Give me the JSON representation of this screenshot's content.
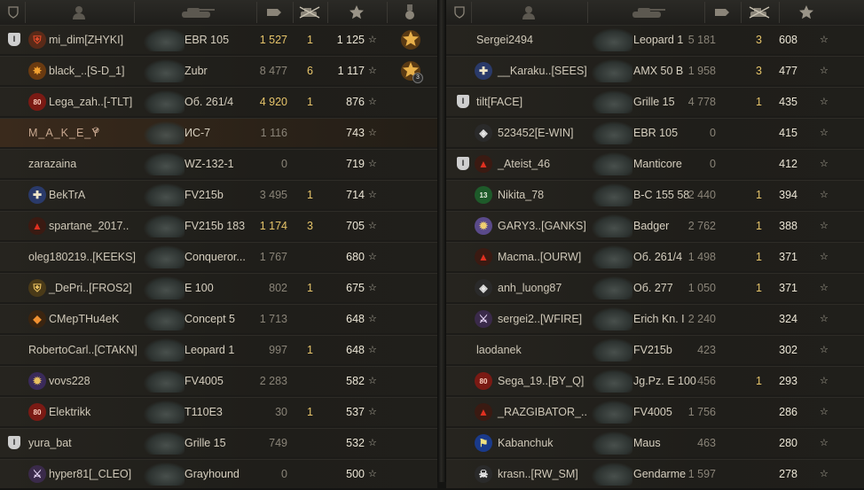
{
  "header_icons": [
    "platoon-shield-icon",
    "player-silhouette-icon",
    "tank-silhouette-icon",
    "damage-shell-icon",
    "frags-tank-icon",
    "experience-star-icon",
    "medal-icon"
  ],
  "left_team": [
    {
      "platoon": "I",
      "clan_icon": "clan-emblem-red-shield",
      "name": "mi_dim[ZHYKI]",
      "tank": "EBR 105",
      "damage": "1 527",
      "damage_hi": true,
      "frags": "1",
      "xp": "1 125",
      "star": "☆",
      "medal": "gold-medal",
      "medal_count": ""
    },
    {
      "platoon": "",
      "clan_icon": "clan-emblem-orange",
      "name": "black_..[S-D_1]",
      "tank": "Zubr",
      "damage": "8 477",
      "damage_hi": false,
      "frags": "6",
      "xp": "1 117",
      "star": "☆",
      "medal": "gold-medal",
      "medal_count": "3"
    },
    {
      "platoon": "",
      "clan_icon": "clan-emblem-red-80",
      "name": "Lega_zah..[-TLT]",
      "tank": "Об. 261/4",
      "damage": "4 920",
      "damage_hi": true,
      "frags": "1",
      "xp": "876",
      "star": "☆",
      "medal": "",
      "medal_count": ""
    },
    {
      "platoon": "",
      "clan_icon": "",
      "name": "M_A_K_E_Y",
      "tank": "ИС-7",
      "damage": "1 116",
      "damage_hi": false,
      "frags": "",
      "xp": "743",
      "star": "☆",
      "medal": "",
      "medal_count": "",
      "player": true
    },
    {
      "platoon": "",
      "clan_icon": "",
      "name": "zarazaina",
      "tank": "WZ-132-1",
      "damage": "0",
      "damage_hi": false,
      "frags": "",
      "xp": "719",
      "star": "☆",
      "medal": "",
      "medal_count": ""
    },
    {
      "platoon": "",
      "clan_icon": "clan-emblem-blue-cross",
      "name": "BekTrA",
      "tank": "FV215b",
      "damage": "3 495",
      "damage_hi": false,
      "frags": "1",
      "xp": "714",
      "star": "☆",
      "medal": "",
      "medal_count": ""
    },
    {
      "platoon": "",
      "clan_icon": "clan-emblem-red-triangle",
      "name": "spartane_2017..",
      "tank": "FV215b 183",
      "damage": "1 174",
      "damage_hi": true,
      "frags": "3",
      "xp": "705",
      "star": "☆",
      "medal": "",
      "medal_count": ""
    },
    {
      "platoon": "",
      "clan_icon": "",
      "name": "oleg180219..[KEEKS]",
      "tank": "Conqueror...",
      "damage": "1 767",
      "damage_hi": false,
      "frags": "",
      "xp": "680",
      "star": "☆",
      "medal": "",
      "medal_count": ""
    },
    {
      "platoon": "",
      "clan_icon": "clan-emblem-gold-shield",
      "name": "_DePri..[FROS2]",
      "tank": "E 100",
      "damage": "802",
      "damage_hi": false,
      "frags": "1",
      "xp": "675",
      "star": "☆",
      "medal": "",
      "medal_count": ""
    },
    {
      "platoon": "",
      "clan_icon": "clan-emblem-orange-diamond",
      "name": "CMepTHu4eK",
      "tank": "Concept 5",
      "damage": "1 713",
      "damage_hi": false,
      "frags": "",
      "xp": "648",
      "star": "☆",
      "medal": "",
      "medal_count": ""
    },
    {
      "platoon": "",
      "clan_icon": "",
      "name": "RobertoCarl..[CTAKN]",
      "tank": "Leopard 1",
      "damage": "997",
      "damage_hi": false,
      "frags": "1",
      "xp": "648",
      "star": "☆",
      "medal": "",
      "medal_count": ""
    },
    {
      "platoon": "",
      "clan_icon": "clan-emblem-purple-gear",
      "name": "vovs228",
      "tank": "FV4005",
      "damage": "2 283",
      "damage_hi": false,
      "frags": "",
      "xp": "582",
      "star": "☆",
      "medal": "",
      "medal_count": ""
    },
    {
      "platoon": "",
      "clan_icon": "clan-emblem-red-80",
      "name": "Elektrikk",
      "tank": "T110E3",
      "damage": "30",
      "damage_hi": false,
      "frags": "1",
      "xp": "537",
      "star": "☆",
      "medal": "",
      "medal_count": ""
    },
    {
      "platoon": "I",
      "clan_icon": "",
      "name": "yura_bat",
      "tank": "Grille 15",
      "damage": "749",
      "damage_hi": false,
      "frags": "",
      "xp": "532",
      "star": "☆",
      "medal": "",
      "medal_count": ""
    },
    {
      "platoon": "",
      "clan_icon": "clan-emblem-purple-sword",
      "name": "hyper81[_CLEO]",
      "tank": "Grayhound",
      "damage": "0",
      "damage_hi": false,
      "frags": "",
      "xp": "500",
      "star": "☆",
      "medal": "",
      "medal_count": ""
    }
  ],
  "right_team": [
    {
      "platoon": "",
      "clan_icon": "",
      "name": "Sergei2494",
      "tank": "Leopard 1",
      "damage": "5 181",
      "frags": "3",
      "xp": "608",
      "star": "☆"
    },
    {
      "platoon": "",
      "clan_icon": "clan-emblem-blue-cross",
      "name": "__Karaku..[SEES]",
      "tank": "AMX 50 B",
      "damage": "1 958",
      "frags": "3",
      "xp": "477",
      "star": "☆"
    },
    {
      "platoon": "I",
      "clan_icon": "",
      "name": "tilt[FACE]",
      "tank": "Grille 15",
      "damage": "4 778",
      "frags": "1",
      "xp": "435",
      "star": "☆"
    },
    {
      "platoon": "",
      "clan_icon": "clan-emblem-white-diamond",
      "name": "523452[E-WIN]",
      "tank": "EBR 105",
      "damage": "0",
      "frags": "",
      "xp": "415",
      "star": "☆"
    },
    {
      "platoon": "I",
      "clan_icon": "clan-emblem-red-triangle",
      "name": "_Ateist_46",
      "tank": "Manticore",
      "damage": "0",
      "frags": "",
      "xp": "412",
      "star": "☆"
    },
    {
      "platoon": "",
      "clan_icon": "clan-emblem-green-13",
      "name": "Nikita_78",
      "tank": "B-C 155 58",
      "damage": "2 440",
      "frags": "1",
      "xp": "394",
      "star": "☆"
    },
    {
      "platoon": "",
      "clan_icon": "clan-emblem-gold-gear",
      "name": "GARY3..[GANKS]",
      "tank": "Badger",
      "damage": "2 762",
      "frags": "1",
      "xp": "388",
      "star": "☆"
    },
    {
      "platoon": "",
      "clan_icon": "clan-emblem-red-triangle",
      "name": "Macma..[OURW]",
      "tank": "Об. 261/4",
      "damage": "1 498",
      "frags": "1",
      "xp": "371",
      "star": "☆"
    },
    {
      "platoon": "",
      "clan_icon": "clan-emblem-white-diamond",
      "name": "anh_luong87",
      "tank": "Об. 277",
      "damage": "1 050",
      "frags": "1",
      "xp": "371",
      "star": "☆"
    },
    {
      "platoon": "",
      "clan_icon": "clan-emblem-purple-sword",
      "name": "sergei2..[WFIRE]",
      "tank": "Erich Kn. I",
      "damage": "2 240",
      "frags": "",
      "xp": "324",
      "star": "☆"
    },
    {
      "platoon": "",
      "clan_icon": "",
      "name": "laodanek",
      "tank": "FV215b",
      "damage": "423",
      "frags": "",
      "xp": "302",
      "star": "☆"
    },
    {
      "platoon": "",
      "clan_icon": "clan-emblem-red-80",
      "name": "Sega_19..[BY_Q]",
      "tank": "Jg.Pz. E 100",
      "damage": "456",
      "frags": "1",
      "xp": "293",
      "star": "☆"
    },
    {
      "platoon": "",
      "clan_icon": "clan-emblem-red-triangle",
      "name": "_RAZGIBATOR_..",
      "tank": "FV4005",
      "damage": "1 756",
      "frags": "",
      "xp": "286",
      "star": "☆"
    },
    {
      "platoon": "",
      "clan_icon": "clan-emblem-blue-banner",
      "name": "Kabanchuk",
      "tank": "Maus",
      "damage": "463",
      "frags": "",
      "xp": "280",
      "star": "☆"
    },
    {
      "platoon": "",
      "clan_icon": "clan-emblem-white-skull",
      "name": "krasn..[RW_SM]",
      "tank": "Gendarme",
      "damage": "1 597",
      "frags": "",
      "xp": "278",
      "star": "☆"
    }
  ],
  "colors": {
    "gold": "#e6c46a",
    "dim": "#8a8478",
    "text": "#d6cfbf",
    "player_row": "#3a2a1c"
  }
}
